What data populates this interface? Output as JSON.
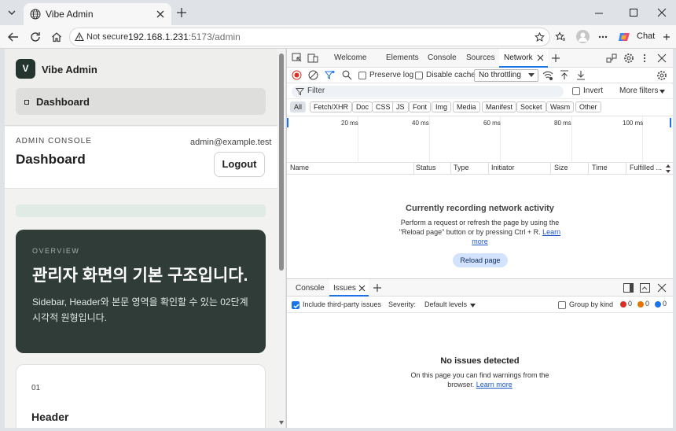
{
  "browser": {
    "tab_title": "Vibe Admin",
    "security": "Not secure",
    "url_host": "192.168.1.231",
    "url_rest": ":5173/admin",
    "chat_label": "Chat"
  },
  "app": {
    "logo_letter": "V",
    "brand": "Vibe Admin",
    "nav_dashboard": "Dashboard",
    "header": {
      "eyebrow": "ADMIN CONSOLE",
      "title": "Dashboard",
      "email": "admin@example.test",
      "logout": "Logout"
    },
    "hero": {
      "eyebrow": "OVERVIEW",
      "title": "관리자 화면의 기본 구조입니다.",
      "desc": "Sidebar, Header와 본문 영역을 확인할 수 있는 02단계 시각적 원형입니다."
    },
    "card": {
      "number": "01",
      "title": "Header"
    }
  },
  "devtools": {
    "tabs": [
      "Welcome",
      "Elements",
      "Console",
      "Sources",
      "Network"
    ],
    "preserve_log": "Preserve log",
    "disable_cache": "Disable cache",
    "throttling": "No throttling",
    "filter_placeholder": "Filter",
    "invert": "Invert",
    "more_filters": "More filters",
    "chips": [
      "All",
      "Fetch/XHR",
      "Doc",
      "CSS",
      "JS",
      "Font",
      "Img",
      "Media",
      "Manifest",
      "Socket",
      "Wasm",
      "Other"
    ],
    "ticks": [
      "20 ms",
      "40 ms",
      "60 ms",
      "80 ms",
      "100 ms"
    ],
    "columns": [
      "Name",
      "Status",
      "Type",
      "Initiator",
      "Size",
      "Time",
      "Fulfilled ..."
    ],
    "empty_title": "Currently recording network activity",
    "empty_text": "Perform a request or refresh the page by using the \"Reload page\" button or by pressing Ctrl + R.",
    "learn_more": "Learn more",
    "reload": "Reload page",
    "drawer": {
      "tabs": [
        "Console",
        "Issues"
      ],
      "third_party": "Include third-party issues",
      "severity": "Severity:",
      "levels": "Default levels",
      "group_by_kind": "Group by kind",
      "counts": [
        "0",
        "0",
        "0"
      ],
      "no_issues": "No issues detected",
      "no_issues_text": "On this page you can find warnings from the browser.",
      "learn_more": "Learn more"
    }
  },
  "colors": {
    "hero_bg": "#2f3c37",
    "accent": "#1a73e8",
    "band": "#e1ebe5"
  }
}
